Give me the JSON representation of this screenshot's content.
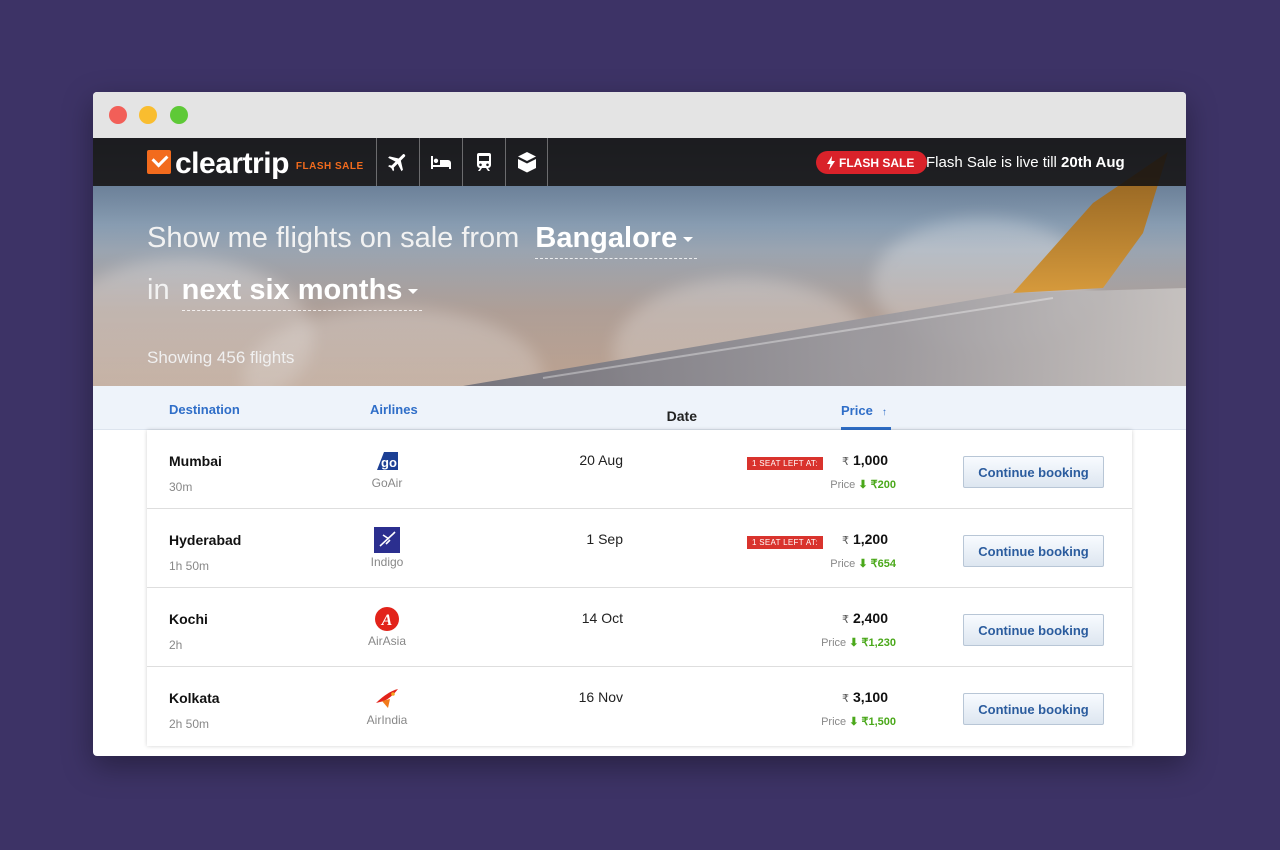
{
  "brand": {
    "name": "cleartrip",
    "sub": "Flash Sale"
  },
  "nav": [
    {
      "icon": "flight-icon"
    },
    {
      "icon": "hotel-icon"
    },
    {
      "icon": "train-icon"
    },
    {
      "icon": "activities-icon"
    }
  ],
  "flash": {
    "badge": "FLASH SALE",
    "info_prefix": "Flash Sale is live till ",
    "info_date": "20th Aug"
  },
  "hero": {
    "line1_prefix": "Show me flights on sale from",
    "origin": "Bangalore",
    "line2_prefix": "in",
    "period": "next six months",
    "showing": "Showing 456 flights"
  },
  "columns": {
    "destination": "Destination",
    "airlines": "Airlines",
    "date": "Date",
    "price": "Price",
    "sort_icon": "↑"
  },
  "flights": [
    {
      "city": "Mumbai",
      "duration": "30m",
      "airline": "GoAir",
      "airline_icon": "goair-logo-icon",
      "date": "20 Aug",
      "seat_tag": "1 seat left at:",
      "currency": "₹",
      "price": "1,000",
      "price_label": "Price",
      "drop": "₹200"
    },
    {
      "city": "Hyderabad",
      "duration": "1h 50m",
      "airline": "Indigo",
      "airline_icon": "indigo-logo-icon",
      "date": "1 Sep",
      "seat_tag": "1 seat left at:",
      "currency": "₹",
      "price": "1,200",
      "price_label": "Price",
      "drop": "₹654"
    },
    {
      "city": "Kochi",
      "duration": "2h",
      "airline": "AirAsia",
      "airline_icon": "airasia-logo-icon",
      "date": "14 Oct",
      "seat_tag": "",
      "currency": "₹",
      "price": "2,400",
      "price_label": "Price",
      "drop": "₹1,230"
    },
    {
      "city": "Kolkata",
      "duration": "2h 50m",
      "airline": "AirIndia",
      "airline_icon": "airindia-logo-icon",
      "date": "16 Nov",
      "seat_tag": "",
      "currency": "₹",
      "price": "3,100",
      "price_label": "Price",
      "drop": "₹1,500"
    }
  ],
  "actions": {
    "continue_label": "Continue booking"
  },
  "colors": {
    "accent": "#2f6ec8",
    "brand": "#f26b1d",
    "sale": "#d9222a",
    "drop": "#4aa81a",
    "background": "#3d3366"
  }
}
